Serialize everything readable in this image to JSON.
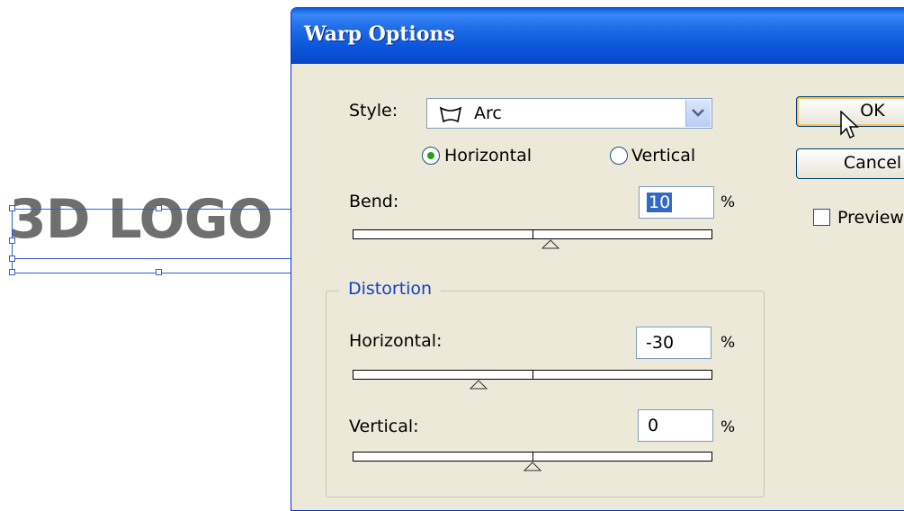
{
  "canvas": {
    "logo_text": "3D LOGO"
  },
  "dialog": {
    "title": "Warp Options",
    "style": {
      "label": "Style:",
      "selected": "Arc",
      "icon": "arc-warp-icon"
    },
    "orientation": {
      "options": [
        "Horizontal",
        "Vertical"
      ],
      "selected": "Horizontal"
    },
    "bend": {
      "label": "Bend:",
      "value": "10",
      "unit": "%",
      "slider_fraction": 0.55
    },
    "distortion": {
      "title": "Distortion",
      "horizontal": {
        "label": "Horizontal:",
        "value": "-30",
        "unit": "%",
        "slider_fraction": 0.35
      },
      "vertical": {
        "label": "Vertical:",
        "value": "0",
        "unit": "%",
        "slider_fraction": 0.5
      }
    },
    "buttons": {
      "ok": "OK",
      "cancel": "Cancel"
    },
    "preview": {
      "label": "Preview",
      "checked": false
    }
  }
}
